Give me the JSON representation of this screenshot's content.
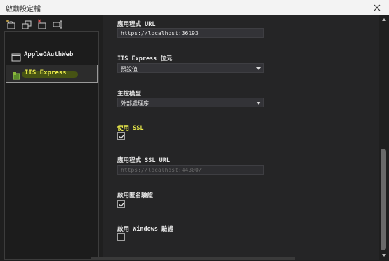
{
  "window": {
    "title": "啟動設定檔"
  },
  "toolbar": [
    "new-profile-icon",
    "copy-profile-icon",
    "delete-profile-icon",
    "rename-profile-icon"
  ],
  "profiles": [
    {
      "label": "AppleOAuthWeb",
      "icon": "window-icon",
      "selected": false
    },
    {
      "label": "IIS Express",
      "icon": "iis-express-icon",
      "selected": true
    }
  ],
  "settings": {
    "app_url": {
      "label": "應用程式 URL",
      "value": "https://localhost:36193"
    },
    "iis_bitness": {
      "label": "IIS Express 位元",
      "value": "預設值"
    },
    "hosting_model": {
      "label": "主控模型",
      "value": "外部處理序"
    },
    "use_ssl": {
      "label": "使用 SSL",
      "checked": true
    },
    "ssl_url": {
      "label": "應用程式 SSL URL",
      "value": "https://localhost:44300/"
    },
    "anonymous_auth": {
      "label": "啟用匿名驗證",
      "checked": true
    },
    "windows_auth": {
      "label": "啟用 Windows 驗證",
      "checked": false
    }
  },
  "colors": {
    "highlight": "#e8e84a",
    "background": "#1f1f1f",
    "panel": "#252526"
  }
}
